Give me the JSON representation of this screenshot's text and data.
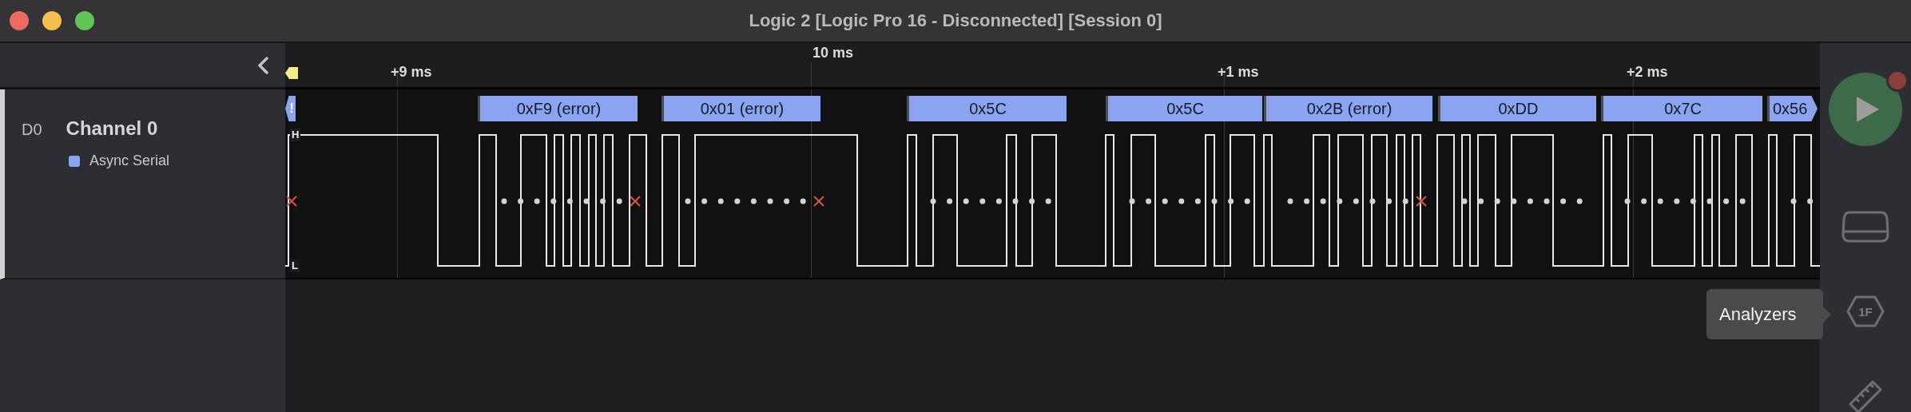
{
  "window": {
    "title": "Logic 2 [Logic Pro 16 - Disconnected] [Session 0]"
  },
  "channels": [
    {
      "index_label": "D0",
      "name": "Channel 0",
      "analyzers": [
        "Async Serial"
      ]
    }
  ],
  "timeline": {
    "ticks": [
      {
        "label": "+9 ms",
        "kind": "offset"
      },
      {
        "label": "10 ms",
        "kind": "major"
      },
      {
        "label": "+1 ms",
        "kind": "offset"
      },
      {
        "label": "+2 ms",
        "kind": "offset"
      }
    ],
    "level_labels": {
      "high": "H",
      "low": "L"
    },
    "frames": [
      {
        "label": "!",
        "kind": "marker"
      },
      {
        "label": "0xF9 (error)",
        "kind": "error"
      },
      {
        "label": "0x01 (error)",
        "kind": "error"
      },
      {
        "label": "0x5C",
        "kind": "data"
      },
      {
        "label": "0x5C",
        "kind": "data"
      },
      {
        "label": "0x2B (error)",
        "kind": "error"
      },
      {
        "label": "0xDD",
        "kind": "data"
      },
      {
        "label": "0x7C",
        "kind": "data"
      },
      {
        "label": "0x56",
        "kind": "data-cut"
      }
    ]
  },
  "toolbar": {
    "play_alert": true,
    "analyzers_glyph": "1F"
  },
  "tooltip": {
    "text": "Analyzers"
  }
}
